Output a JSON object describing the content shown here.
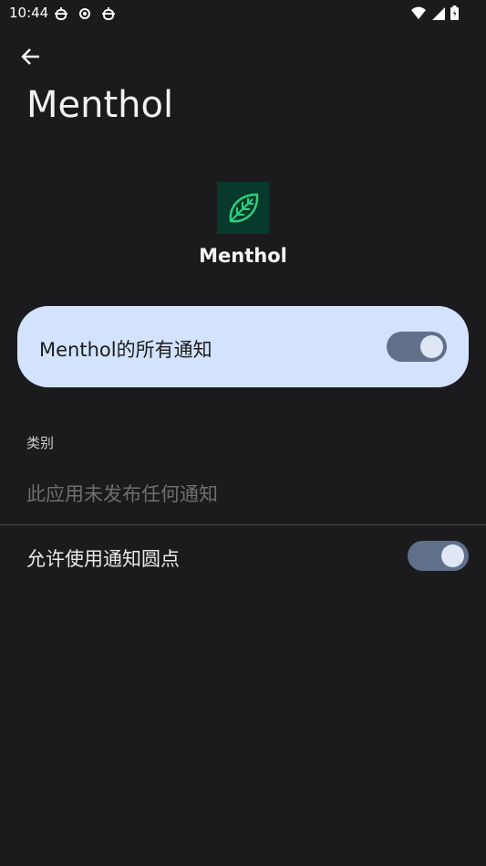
{
  "status_bar": {
    "time": "10:44",
    "left_icons": [
      "bug-icon",
      "settings-icon",
      "bug-icon"
    ],
    "right_icons": [
      "wifi-icon",
      "signal-icon",
      "battery-icon"
    ]
  },
  "header": {
    "title": "Menthol"
  },
  "app": {
    "name": "Menthol",
    "icon": "leaf-icon",
    "icon_bg": "#073a2c",
    "icon_color": "#2fd17d"
  },
  "main_toggle": {
    "label": "Menthol的所有通知",
    "enabled": true
  },
  "categories": {
    "header": "类别",
    "empty_text": "此应用未发布任何通知"
  },
  "notification_dots": {
    "label": "允许使用通知圆点",
    "enabled": true
  },
  "colors": {
    "background": "#1b1b1d",
    "card": "#d3e3fd",
    "switch_track": "#60708a",
    "switch_knob": "#dfe7f5"
  }
}
